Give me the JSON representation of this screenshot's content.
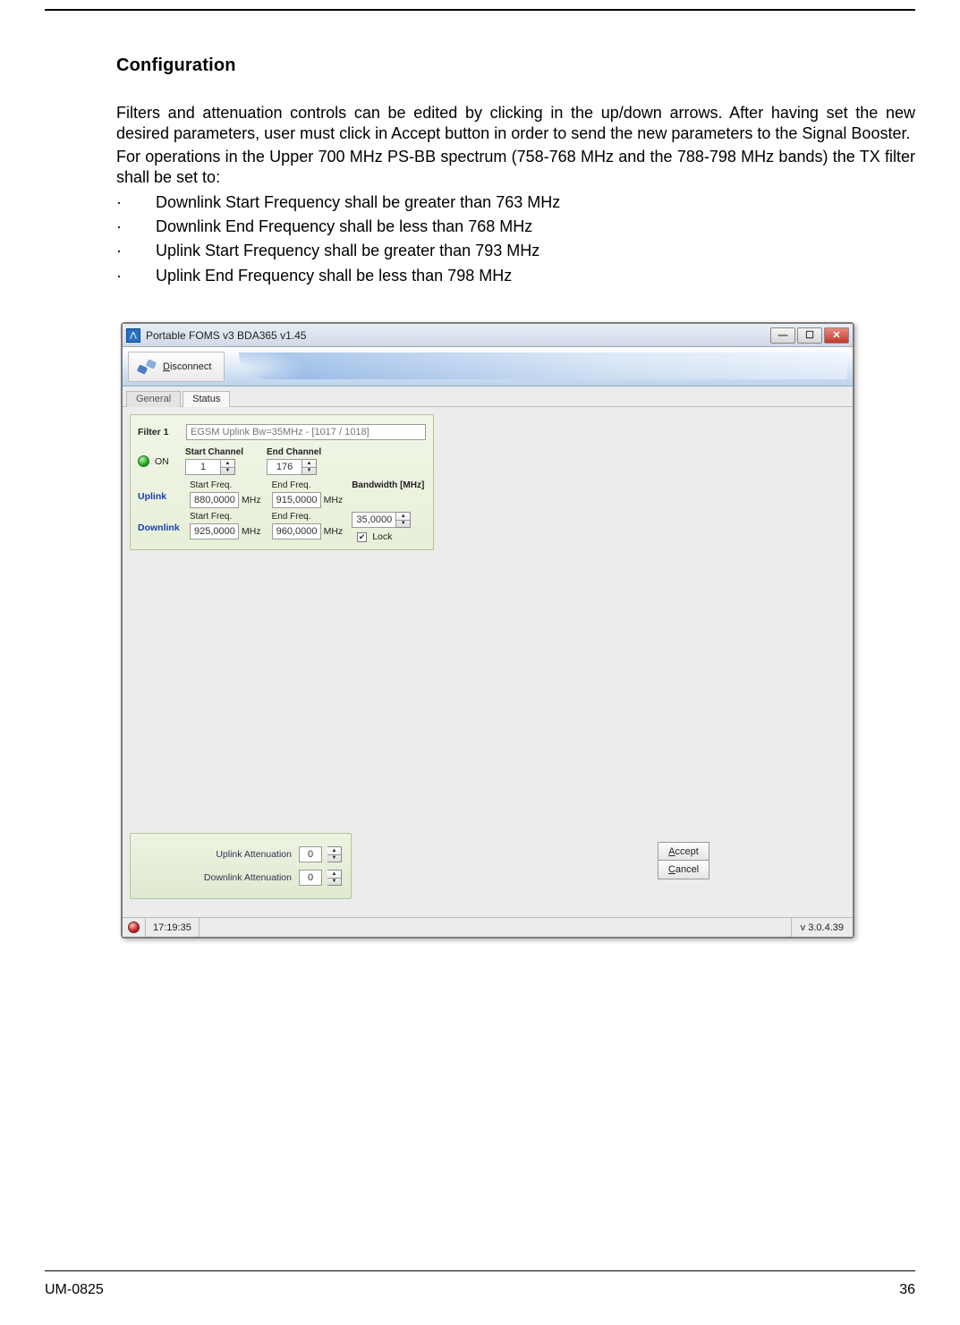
{
  "doc": {
    "heading": "Configuration",
    "p1": "Filters and attenuation controls can be edited by clicking in the up/down arrows.  After having set the new desired parameters, user must click in Accept button in order to send the new parameters to the Signal Booster.",
    "p2": "For operations in the Upper 700 MHz PS-BB spectrum (758-768 MHz and the 788-798 MHz bands) the TX filter shall be set to:",
    "bullets": [
      "Downlink Start Frequency shall be greater than 763 MHz",
      "Downlink End Frequency shall be less than 768 MHz",
      "Uplink Start Frequency shall be greater than 793 MHz",
      "Uplink End Frequency shall be less than 798 MHz"
    ],
    "footer_left": "UM-0825",
    "footer_right": "36",
    "bullet_char": "·"
  },
  "win": {
    "title": "Portable FOMS v3  BDA365 v1.45",
    "btn_min": "—",
    "btn_max": "☐",
    "btn_close": "✕",
    "disconnect": {
      "prefix": "D",
      "rest": "isconnect"
    },
    "tabs": {
      "general": "General",
      "status": "Status"
    },
    "filter": {
      "name": "Filter 1",
      "desc": "EGSM Uplink Bw=35MHz - [1017 / 1018]",
      "on": "ON",
      "start_ch_lbl": "Start Channel",
      "end_ch_lbl": "End Channel",
      "start_ch": "1",
      "end_ch": "176",
      "uplink": "Uplink",
      "downlink": "Downlink",
      "start_freq_lbl": "Start Freq.",
      "end_freq_lbl": "End Freq.",
      "ul_start": "880,0000",
      "ul_end": "915,0000",
      "dl_start": "925,0000",
      "dl_end": "960,0000",
      "mhz": "MHz",
      "bw_lbl": "Bandwidth [MHz]",
      "bw": "35,0000",
      "lock": "Lock",
      "lock_check": "✔"
    },
    "att": {
      "ul_lbl": "Uplink Attenuation",
      "dl_lbl": "Downlink Attenuation",
      "ul_val": "0",
      "dl_val": "0"
    },
    "buttons": {
      "accept_u": "A",
      "accept_r": "ccept",
      "cancel_u": "C",
      "cancel_r": "ancel"
    },
    "status": {
      "time": "17:19:35",
      "version": "v 3.0.4.39"
    },
    "tri_up": "▲",
    "tri_dn": "▼"
  }
}
